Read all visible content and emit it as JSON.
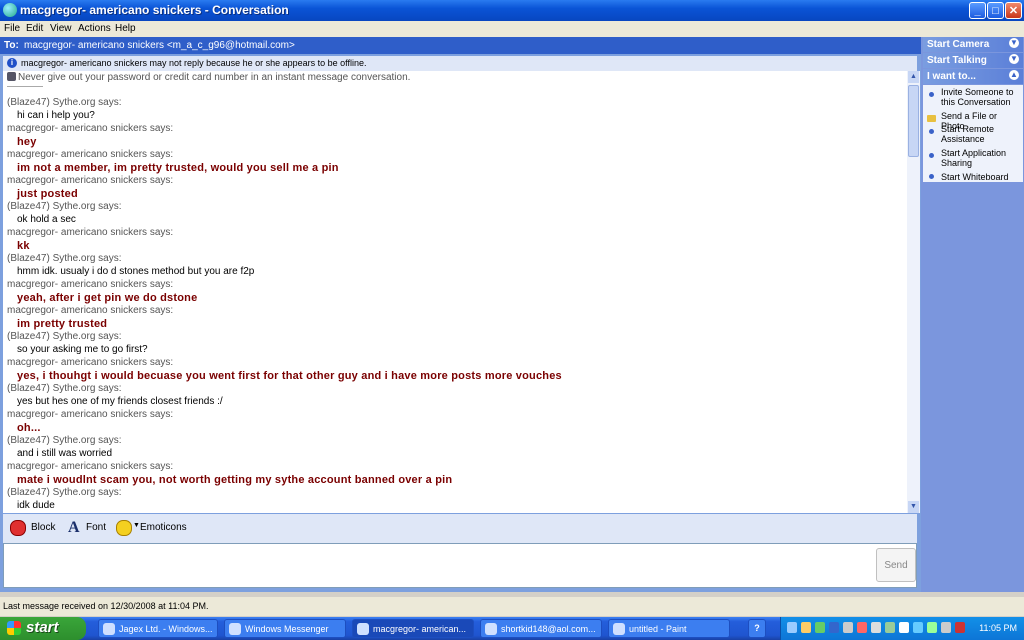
{
  "window": {
    "title": "macgregor- americano snickers - Conversation",
    "buttons": {
      "minimize": "_",
      "maximize": "□",
      "close": "✕"
    }
  },
  "menu": [
    "File",
    "Edit",
    "View",
    "Actions",
    "Help"
  ],
  "to_bar": {
    "label": "To:",
    "recipient": "macgregor- americano snickers <m_a_c_g96@hotmail.com>"
  },
  "info_bar": {
    "text": "macgregor- americano snickers may not reply because he or she appears to be offline."
  },
  "warning": "Never give out your password or credit card number in an instant message conversation.",
  "transcript": [
    {
      "who": "(Blaze47) Sythe.org says:",
      "text": "hi can i help you?",
      "self": false
    },
    {
      "who": "macgregor- americano snickers says:",
      "text": "hey",
      "self": true
    },
    {
      "who": "macgregor- americano snickers says:",
      "text": "im not a member, im pretty trusted, would you sell me a pin",
      "self": true
    },
    {
      "who": "macgregor- americano snickers says:",
      "text": "just posted",
      "self": true
    },
    {
      "who": "(Blaze47) Sythe.org says:",
      "text": "ok hold a sec",
      "self": false
    },
    {
      "who": "macgregor- americano snickers says:",
      "text": "kk",
      "self": true
    },
    {
      "who": "(Blaze47) Sythe.org says:",
      "text": "hmm idk. usualy i do d stones method but you are f2p",
      "self": false
    },
    {
      "who": "macgregor- americano snickers says:",
      "text": "yeah, after i get pin we do dstone",
      "self": true
    },
    {
      "who": "macgregor- americano snickers says:",
      "text": "im pretty trusted",
      "self": true
    },
    {
      "who": "(Blaze47) Sythe.org says:",
      "text": "so your asking me to go first?",
      "self": false
    },
    {
      "who": "macgregor- americano snickers says:",
      "text": "yes, i thouhgt i would becuase you went first for that other guy and i have more posts  more vouches",
      "self": true
    },
    {
      "who": "(Blaze47) Sythe.org says:",
      "text": "yes but hes one of my friends closest friends :/",
      "self": false
    },
    {
      "who": "macgregor- americano snickers says:",
      "text": "oh...",
      "self": true
    },
    {
      "who": "(Blaze47) Sythe.org says:",
      "text": "and i still was worried",
      "self": false
    },
    {
      "who": "macgregor- americano snickers says:",
      "text": "mate i woudlnt scam you, not worth getting my sythe account banned over a pin",
      "self": true
    },
    {
      "who": "(Blaze47) Sythe.org says:",
      "text": "idk dude",
      "self": false
    },
    {
      "who": "macgregor- americano snickers says:",
      "text": "",
      "self": true
    }
  ],
  "toolbar": {
    "block": "Block",
    "font": "Font",
    "emoticons": "Emoticons"
  },
  "composer": {
    "value": "",
    "send": "Send"
  },
  "right_panel": {
    "start_camera": "Start Camera",
    "start_talking": "Start Talking",
    "i_want_to": "I want to...",
    "items": [
      "Invite Someone to this Conversation",
      "Send a File or Photo",
      "Start Remote Assistance",
      "Start Application Sharing",
      "Start Whiteboard"
    ]
  },
  "status": "Last message received on 12/30/2008 at 11:04 PM.",
  "taskbar": {
    "start": "start",
    "tasks": [
      {
        "label": "Jagex Ltd. - Windows..."
      },
      {
        "label": "Windows Messenger"
      },
      {
        "label": "macgregor- american..."
      },
      {
        "label": "shortkid148@aol.com..."
      },
      {
        "label": "untitled - Paint"
      }
    ],
    "clock": "11:05 PM"
  },
  "colors": {
    "self_text": "#7a0000",
    "titlebar": "#0a54d6",
    "panel": "#7b96dd"
  }
}
